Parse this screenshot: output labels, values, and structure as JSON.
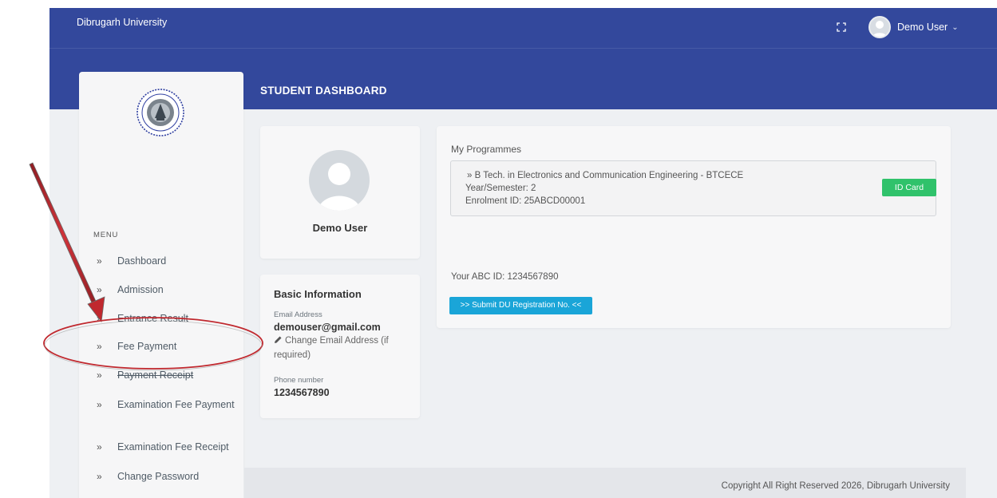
{
  "header": {
    "brand": "Dibrugarh University",
    "user_name": "Demo User",
    "page_title": "STUDENT DASHBOARD"
  },
  "icons": {
    "fullscreen": "fullscreen-icon",
    "user_avatar": "user-avatar",
    "chevron": "chevron-down-icon",
    "menu_chevron": "double-chevron-right-icon",
    "edit": "pencil-icon"
  },
  "sidebar": {
    "menu_title": "MENU",
    "items": [
      {
        "label": "Dashboard"
      },
      {
        "label": "Admission"
      },
      {
        "label": "Entrance Result"
      },
      {
        "label": "Fee Payment"
      },
      {
        "label": "Payment Receipt"
      },
      {
        "label": "Examination Fee Payment"
      },
      {
        "label": "Examination Fee Receipt"
      },
      {
        "label": "Change Password"
      }
    ]
  },
  "profile": {
    "name": "Demo User"
  },
  "basic_info": {
    "title": "Basic Information",
    "email_label": "Email Address",
    "email": "demouser@gmail.com",
    "change_email": "Change Email Address (if required)",
    "phone_label": "Phone number",
    "phone": "1234567890"
  },
  "programmes": {
    "heading": "My Programmes",
    "programme": "» B Tech. in Electronics and Communication Engineering - BTCECE",
    "year_semester": "Year/Semester: 2",
    "enrolment": "Enrolment ID: 25ABCD00001",
    "id_card_button": "ID Card",
    "abc_id": "Your ABC ID: 1234567890",
    "submit_button": ">> Submit DU Registration No. <<"
  },
  "footer": {
    "text": "Copyright All Right Reserved 2026, Dibrugarh University"
  },
  "colors": {
    "header": "#33489c",
    "id_card": "#30c26b",
    "submit": "#1aa5d8",
    "annotation": "#c0282e"
  }
}
